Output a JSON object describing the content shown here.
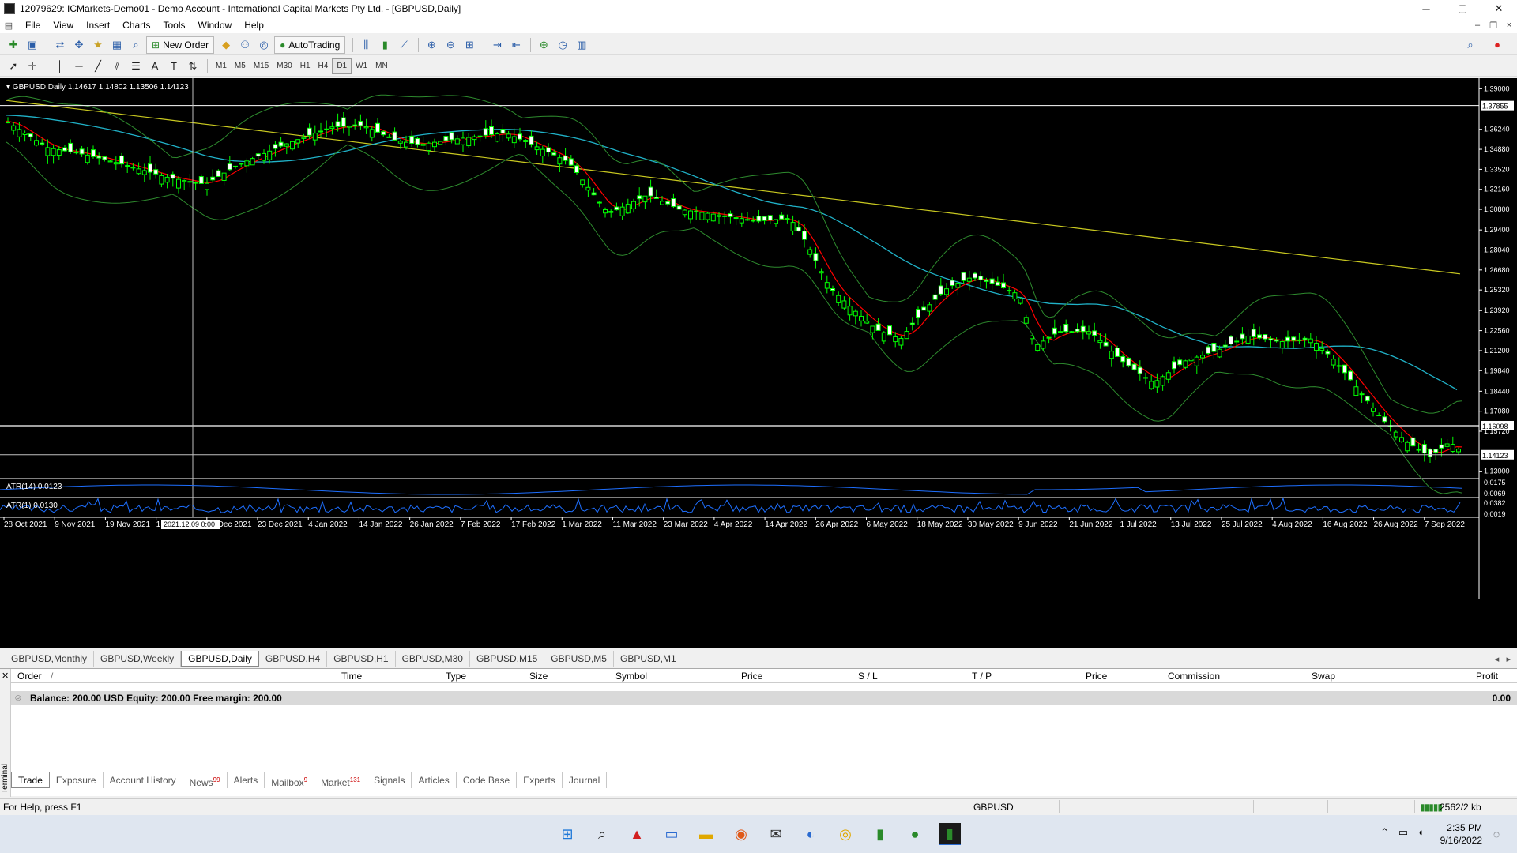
{
  "window": {
    "title": "12079629: ICMarkets-Demo01 - Demo Account - International Capital Markets Pty Ltd. - [GBPUSD,Daily]",
    "min": "─",
    "max": "▢",
    "close": "✕"
  },
  "menu": [
    "File",
    "View",
    "Insert",
    "Charts",
    "Tools",
    "Window",
    "Help"
  ],
  "toolbar": {
    "new_order": "New Order",
    "autotrading": "AutoTrading",
    "timeframes": [
      "M1",
      "M5",
      "M15",
      "M30",
      "H1",
      "H4",
      "D1",
      "W1",
      "MN"
    ],
    "active_tf": "D1"
  },
  "chart": {
    "symbol_header": "GBPUSD,Daily",
    "ohlc": "1.14617 1.14802 1.13506 1.14123",
    "crosshair_date": "2021.12.09 0:00",
    "price_labels": [
      "1.39000",
      "1.37855",
      "1.36240",
      "1.34880",
      "1.33520",
      "1.32160",
      "1.30800",
      "1.29400",
      "1.28040",
      "1.26680",
      "1.25320",
      "1.23920",
      "1.22560",
      "1.21200",
      "1.19840",
      "1.18440",
      "1.17080",
      "1.16098",
      "1.15720",
      "1.14123",
      "1.13000"
    ],
    "current_price": "1.14123",
    "level_price": "1.16098",
    "top_level_price": "1.37855",
    "date_labels": [
      "28 Oct 2021",
      "9 Nov 2021",
      "19 Nov 2021",
      "1 Dec 2021",
      "13 Dec 2021",
      "23 Dec 2021",
      "4 Jan 2022",
      "14 Jan 2022",
      "26 Jan 2022",
      "7 Feb 2022",
      "17 Feb 2022",
      "1 Mar 2022",
      "11 Mar 2022",
      "23 Mar 2022",
      "4 Apr 2022",
      "14 Apr 2022",
      "26 Apr 2022",
      "6 May 2022",
      "18 May 2022",
      "30 May 2022",
      "9 Jun 2022",
      "21 Jun 2022",
      "1 Jul 2022",
      "13 Jul 2022",
      "25 Jul 2022",
      "4 Aug 2022",
      "16 Aug 2022",
      "26 Aug 2022",
      "7 Sep 2022"
    ],
    "atr14": {
      "label": "ATR(14) 0.0123",
      "scale": [
        "0.0175",
        "0.0069"
      ]
    },
    "atr1": {
      "label": "ATR(1) 0.0130",
      "scale": [
        "0.0382",
        "0.0019"
      ]
    },
    "colors": {
      "bg": "#000000",
      "candle": "#00ff00",
      "ma_fast": "#ff0000",
      "ma_mid": "#20b2c8",
      "ma_slow": "#c8c820",
      "bands": "#2e8b2e",
      "atr": "#1e6fff"
    }
  },
  "chart_tabs": [
    "GBPUSD,Monthly",
    "GBPUSD,Weekly",
    "GBPUSD,Daily",
    "GBPUSD,H4",
    "GBPUSD,H1",
    "GBPUSD,M30",
    "GBPUSD,M15",
    "GBPUSD,M5",
    "GBPUSD,M1"
  ],
  "terminal": {
    "side_label": "Terminal",
    "columns": [
      "Order",
      "Time",
      "Type",
      "Size",
      "Symbol",
      "Price",
      "S / L",
      "T / P",
      "Price",
      "Commission",
      "Swap",
      "Profit"
    ],
    "balance_text": "Balance: 200.00 USD  Equity: 200.00  Free margin: 200.00",
    "profit": "0.00",
    "tabs": [
      {
        "label": "Trade",
        "badge": ""
      },
      {
        "label": "Exposure",
        "badge": ""
      },
      {
        "label": "Account History",
        "badge": ""
      },
      {
        "label": "News",
        "badge": "99"
      },
      {
        "label": "Alerts",
        "badge": ""
      },
      {
        "label": "Mailbox",
        "badge": "9"
      },
      {
        "label": "Market",
        "badge": "131"
      },
      {
        "label": "Signals",
        "badge": ""
      },
      {
        "label": "Articles",
        "badge": ""
      },
      {
        "label": "Code Base",
        "badge": ""
      },
      {
        "label": "Experts",
        "badge": ""
      },
      {
        "label": "Journal",
        "badge": ""
      }
    ]
  },
  "status": {
    "help": "For Help, press F1",
    "symbol": "GBPUSD",
    "traffic": "2562/2 kb"
  },
  "taskbar": {
    "time": "2:35 PM",
    "date": "9/16/2022"
  }
}
